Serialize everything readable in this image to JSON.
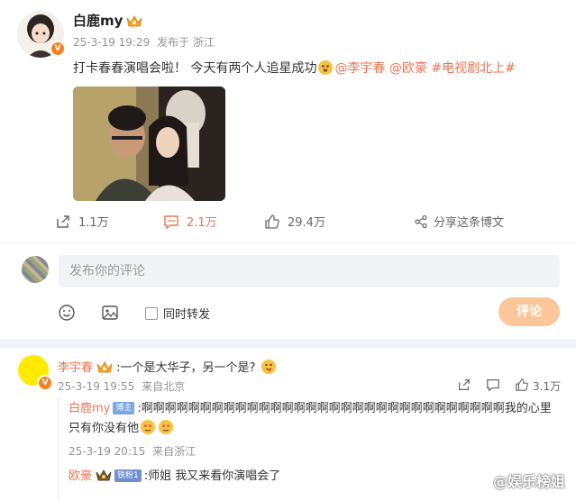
{
  "post": {
    "author": "白鹿my",
    "timestamp": "25-3-19 19:29",
    "source": "发布于 浙江",
    "text_prefix": "打卡春春演唱会啦！ 今天有两个人追星成功",
    "mention_1": "@李宇春",
    "mention_2": "@欧豪",
    "topic": "#电视剧北上#",
    "verified_badge": "V",
    "colors": {
      "accent": "#eb7350",
      "meta": "#939393",
      "like_orange": "#f6821f"
    }
  },
  "actions": {
    "repost_count": "1.1万",
    "comment_count": "2.1万",
    "like_count": "29.4万",
    "share_label": "分享这条博文",
    "icons": [
      "repost-icon",
      "comment-icon",
      "like-icon",
      "share-icon"
    ]
  },
  "composer": {
    "placeholder": "发布你的评论",
    "repost_checkbox_label": "同时转发",
    "submit_label": "评论",
    "icons": [
      "emoji-icon",
      "image-icon"
    ]
  },
  "comments": [
    {
      "author": "李宇春",
      "text": ":一个是大华子，另一个是?",
      "timestamp": "25-3-19 19:55",
      "source": "来自北京",
      "like_count": "3.1万",
      "replies": [
        {
          "author": "白鹿my",
          "tag": "博主",
          "text": ":啊啊啊啊啊啊啊啊啊啊啊啊啊啊啊啊啊啊啊啊啊啊啊啊啊啊啊啊啊啊啊我的心里只有你没有他",
          "timestamp": "25-3-19 20:15",
          "source": "来自浙江"
        },
        {
          "author": "欧豪",
          "tag": "铁粉1",
          "text": ":师姐 我又来看你演唱会了"
        }
      ]
    }
  ],
  "watermark": "@娱乐榜姐"
}
